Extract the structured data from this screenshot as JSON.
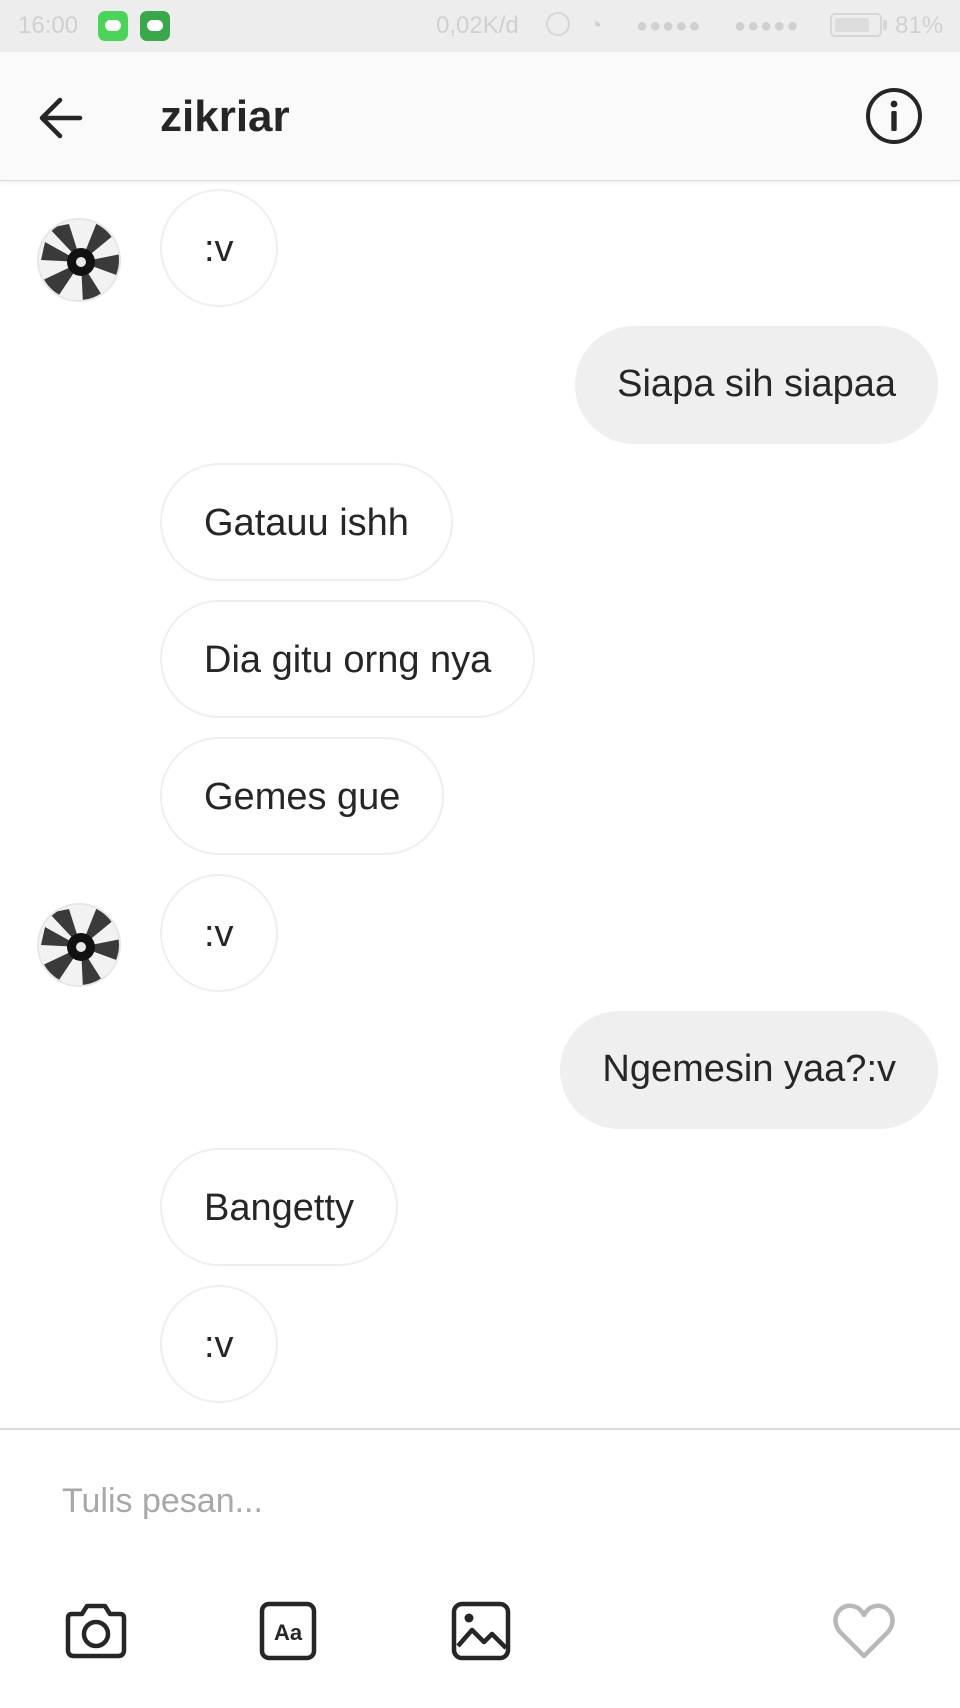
{
  "status_bar": {
    "time": "16:00",
    "speed": "0,02K/d",
    "battery": "81%",
    "signal_dots_1": "●●●●●",
    "signal_dots_2": "●●●●●",
    "wifi_glyph": "◔"
  },
  "header": {
    "title": "zikriar",
    "back_icon": "arrow-left-icon",
    "info_icon": "info-icon"
  },
  "messages": [
    {
      "side": "in",
      "text": ":v",
      "avatar": true
    },
    {
      "side": "out",
      "text": "Siapa sih siapaa"
    },
    {
      "side": "in",
      "text": "Gatauu ishh"
    },
    {
      "side": "in",
      "text": "Dia gitu orng nya"
    },
    {
      "side": "in",
      "text": "Gemes gue"
    },
    {
      "side": "in",
      "text": ":v",
      "avatar": true
    },
    {
      "side": "out",
      "text": "Ngemesin yaa?:v"
    },
    {
      "side": "in",
      "text": "Bangetty"
    },
    {
      "side": "in",
      "text": ":v"
    }
  ],
  "composer": {
    "placeholder": "Tulis pesan...",
    "value": "",
    "tools": [
      "camera-icon",
      "text-format-icon",
      "gallery-icon",
      "heart-icon"
    ],
    "text_format_label": "Aa"
  },
  "colors": {
    "incoming_border": "#efefef",
    "outgoing_bg": "#efefef",
    "text": "#262626",
    "placeholder": "#a8a8a8"
  }
}
